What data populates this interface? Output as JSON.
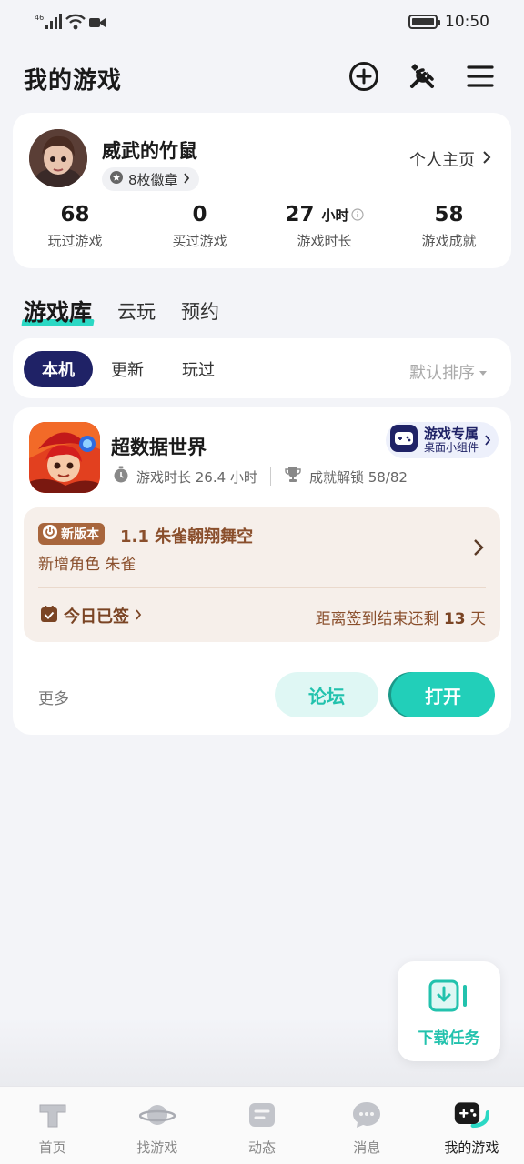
{
  "status_bar": {
    "time": "10:50",
    "signal_label": "46"
  },
  "header": {
    "title": "我的游戏"
  },
  "profile": {
    "username": "威武的竹鼠",
    "badges": "8枚徽章",
    "homepage_link": "个人主页",
    "stats": [
      {
        "value": "68",
        "unit": "",
        "label": "玩过游戏"
      },
      {
        "value": "0",
        "unit": "",
        "label": "买过游戏"
      },
      {
        "value": "27",
        "unit": "小时",
        "label": "游戏时长"
      },
      {
        "value": "58",
        "unit": "",
        "label": "游戏成就"
      }
    ]
  },
  "tabs": [
    {
      "label": "游戏库",
      "active": true
    },
    {
      "label": "云玩",
      "active": false
    },
    {
      "label": "预约",
      "active": false
    }
  ],
  "filters": {
    "chips": [
      {
        "label": "本机",
        "active": true
      },
      {
        "label": "更新",
        "active": false
      },
      {
        "label": "玩过",
        "active": false
      }
    ],
    "sort": "默认排序"
  },
  "game": {
    "name": "超数据世界",
    "widget_title": "游戏专属",
    "widget_sub": "桌面小组件",
    "playtime": "游戏时长 26.4 小时",
    "achievements": "成就解锁 58/82",
    "new_version_tag": "新版本",
    "update_title": "1.1 朱雀翱翔舞空",
    "update_desc": "新增角色 朱雀",
    "signed_in": "今日已签",
    "countdown_prefix": "距离签到结束还剩",
    "countdown_days": "13",
    "countdown_suffix": "天",
    "more": "更多",
    "forum_button": "论坛",
    "open_button": "打开"
  },
  "fab": {
    "label": "下载任务"
  },
  "tabbar": [
    {
      "label": "首页",
      "icon": "home-icon",
      "active": false
    },
    {
      "label": "找游戏",
      "icon": "planet-icon",
      "active": false
    },
    {
      "label": "动态",
      "icon": "feed-icon",
      "active": false
    },
    {
      "label": "消息",
      "icon": "chat-icon",
      "active": false
    },
    {
      "label": "我的游戏",
      "icon": "gamepad-icon",
      "active": true
    }
  ],
  "colors": {
    "accent": "#22cfb9",
    "navy": "#1f2266",
    "update_brown": "#8a4f2c"
  }
}
